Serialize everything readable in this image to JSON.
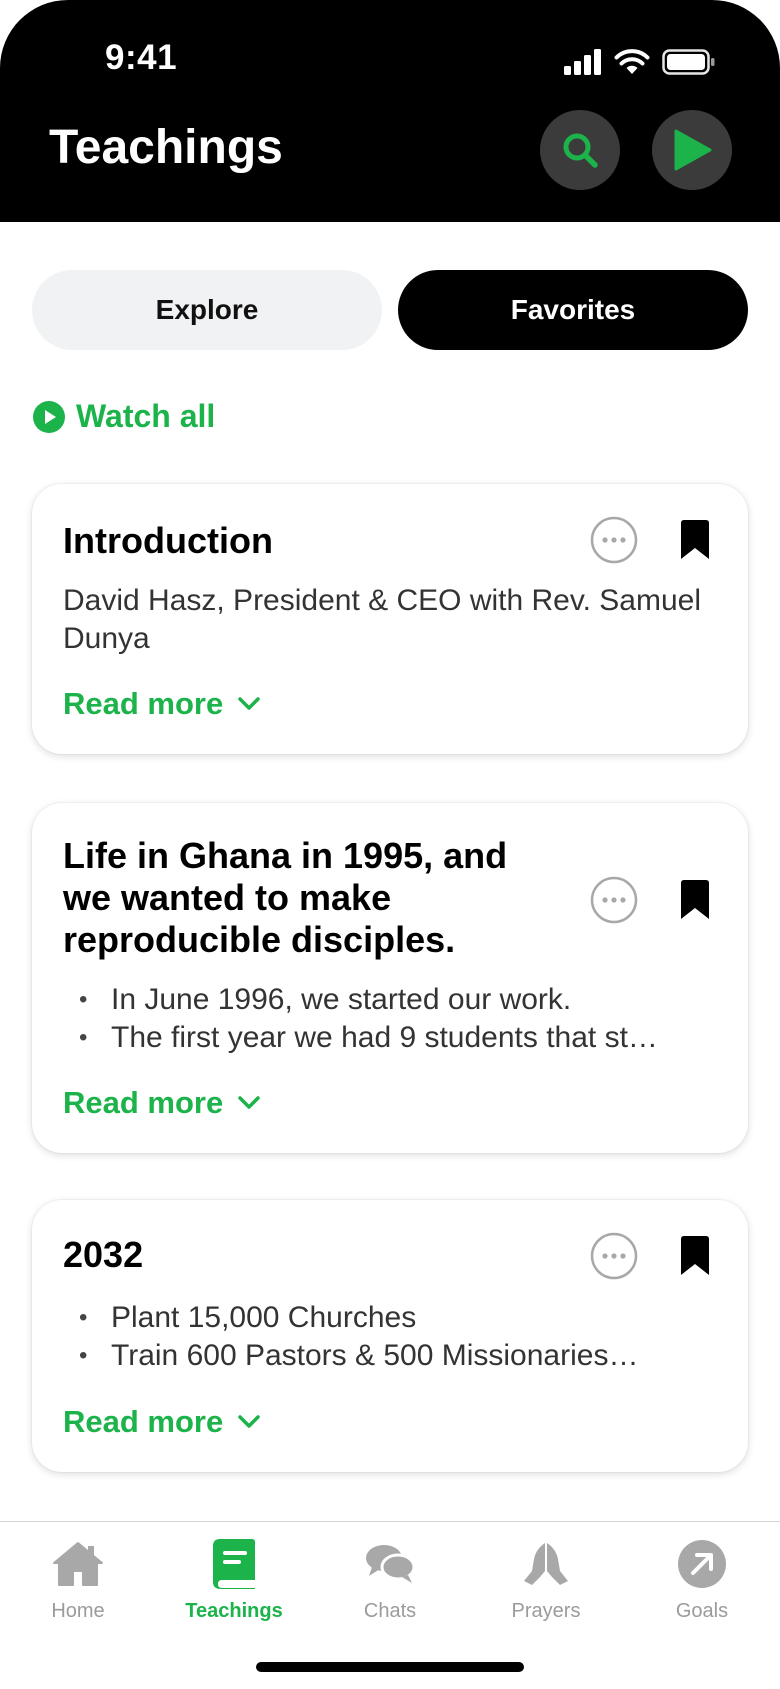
{
  "status_bar": {
    "time": "9:41"
  },
  "header": {
    "title": "Teachings"
  },
  "tabs": [
    {
      "label": "Explore",
      "active": false
    },
    {
      "label": "Favorites",
      "active": true
    }
  ],
  "watch_all": {
    "label": "Watch all"
  },
  "cards": [
    {
      "title": "Introduction",
      "description": "David Hasz, President & CEO with Rev. Samuel Dunya",
      "read_more": "Read more"
    },
    {
      "title": "Life in Ghana in 1995, and we wanted to make reproducible disciples.",
      "bullets": [
        "In June 1996, we started our work.",
        "The first year we had 9 students that st…"
      ],
      "read_more": "Read more"
    },
    {
      "title": "2032",
      "bullets": [
        "Plant 15,000 Churches",
        "Train 600 Pastors & 500 Missionaries…"
      ],
      "read_more": "Read more"
    }
  ],
  "tab_bar": {
    "items": [
      {
        "label": "Home",
        "icon": "home-icon",
        "active": false
      },
      {
        "label": "Teachings",
        "icon": "book-icon",
        "active": true
      },
      {
        "label": "Chats",
        "icon": "chat-bubbles-icon",
        "active": false
      },
      {
        "label": "Prayers",
        "icon": "praying-hands-icon",
        "active": false
      },
      {
        "label": "Goals",
        "icon": "arrow-up-right-icon",
        "active": false
      }
    ]
  },
  "colors": {
    "accent": "#1bb34a",
    "header_bg": "#000000",
    "inactive": "#9b9b9b",
    "icon_gray": "#a8a8a8"
  }
}
